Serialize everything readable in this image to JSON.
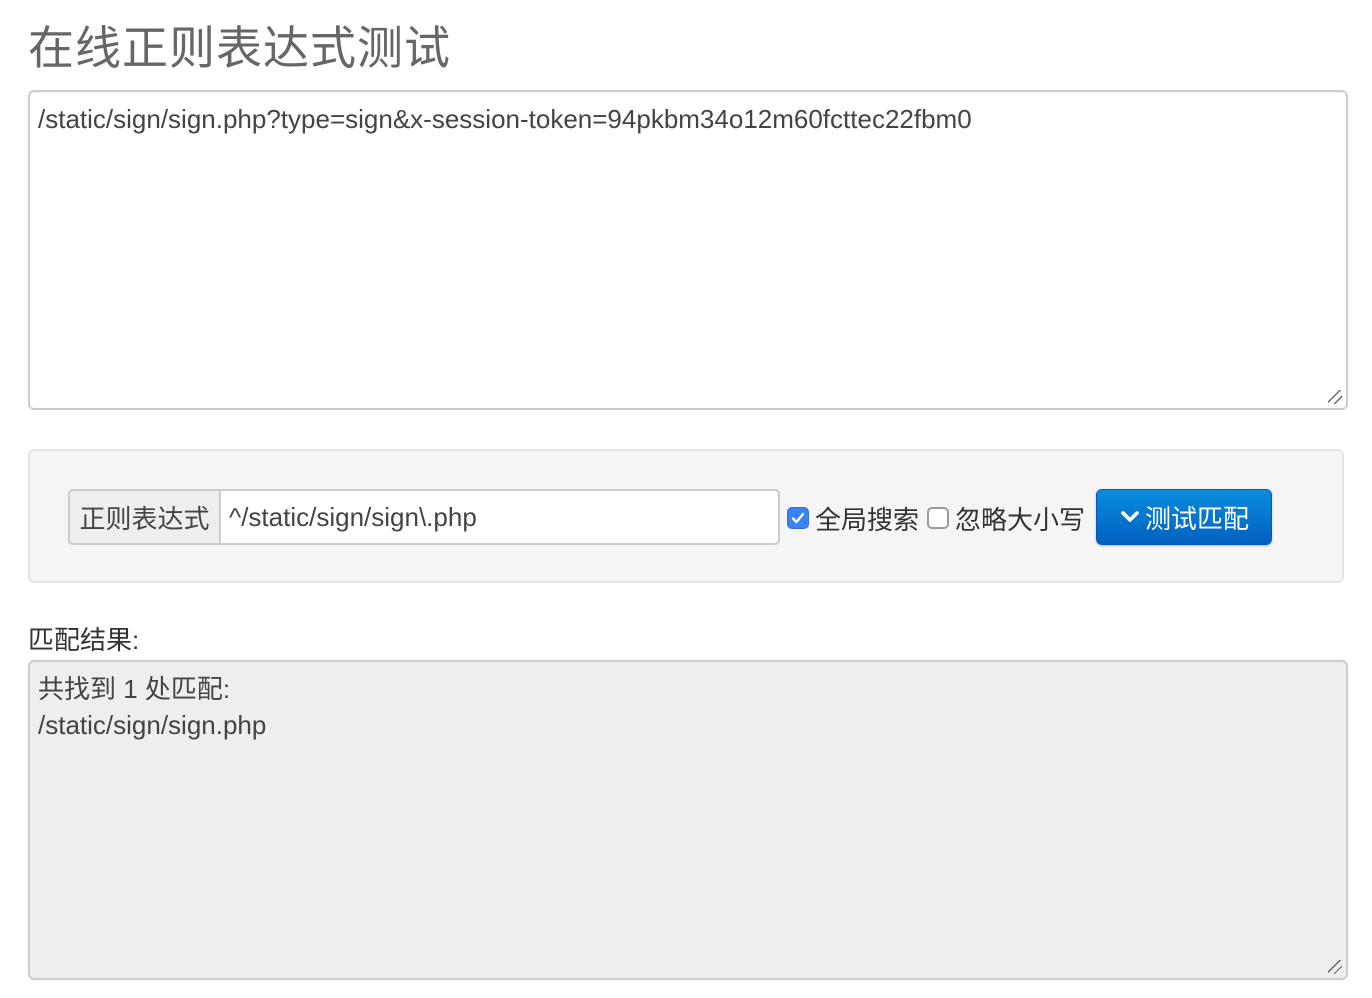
{
  "page_title": "在线正则表达式测试",
  "source": {
    "text": "/static/sign/sign.php?type=sign&x-session-token=94pkbm34o12m60fcttec22fbm0"
  },
  "regex_form": {
    "addon_label": "正则表达式",
    "pattern_value": "^/static/sign/sign\\.php",
    "global_search": {
      "label": "全局搜索",
      "checked": true
    },
    "ignore_case": {
      "label": "忽略大小写",
      "checked": false
    },
    "test_button_label": "测试匹配"
  },
  "result": {
    "label": "匹配结果:",
    "summary": "共找到 1 处匹配:",
    "matches": [
      "/static/sign/sign.php"
    ]
  },
  "colors": {
    "button_top": "#0a8dde",
    "button_bottom": "#0060c0",
    "checkbox_checked": "#3b82f6"
  },
  "icons": {
    "button_icon": "chevron-down-icon",
    "checkbox_checked_icon": "check-icon",
    "resize_icon": "resize-grip-icon"
  }
}
